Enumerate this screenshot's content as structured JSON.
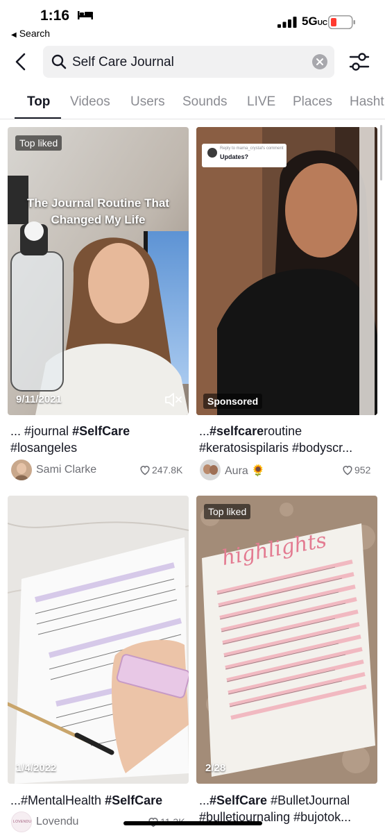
{
  "status": {
    "time": "1:16",
    "back_app": "Search",
    "network": "5G",
    "network_suffix": "UC"
  },
  "search": {
    "query": "Self Care Journal"
  },
  "tabs": [
    "Top",
    "Videos",
    "Users",
    "Sounds",
    "LIVE",
    "Places",
    "Hasht"
  ],
  "results": [
    {
      "badge": "Top liked",
      "overlay_title_line1": "The Journal Routine That",
      "overlay_title_line2": "Changed My Life",
      "date": "9/11/2021",
      "caption_line1_pre": "... #journal ",
      "caption_line1_bold": "#SelfCare",
      "caption_line2": "#losangeles",
      "author": "Sami Clarke",
      "likes": "247.8K"
    },
    {
      "reply_to": "Reply to mama_crystal's comment",
      "reply_text": "Updates?",
      "badge": "Sponsored",
      "caption_line1_pre": "...",
      "caption_line1_bold": "#selfcare",
      "caption_line1_post": "routine",
      "caption_line2": "#keratosispilaris #bodyscr...",
      "author": "Aura 🌻",
      "likes": "952"
    },
    {
      "date": "1/4/2022",
      "caption_line1_pre": "...#MentalHealth ",
      "caption_line1_bold": "#SelfCare",
      "author": "Lovendu",
      "avatar_text": "LOVENDU",
      "likes": "11.3K"
    },
    {
      "badge": "Top liked",
      "page_heading": "highlights",
      "date": "2/28",
      "caption_line1_pre": "...",
      "caption_line1_bold": "#SelfCare",
      "caption_line1_post": " #BulletJournal",
      "caption_line2": "#bulletjournaling #bujotok..."
    }
  ],
  "colors": {
    "active_text": "#161823",
    "muted_text": "#8a8b91",
    "search_bg": "#f1f1f2",
    "battery_low": "#ff3b30"
  }
}
